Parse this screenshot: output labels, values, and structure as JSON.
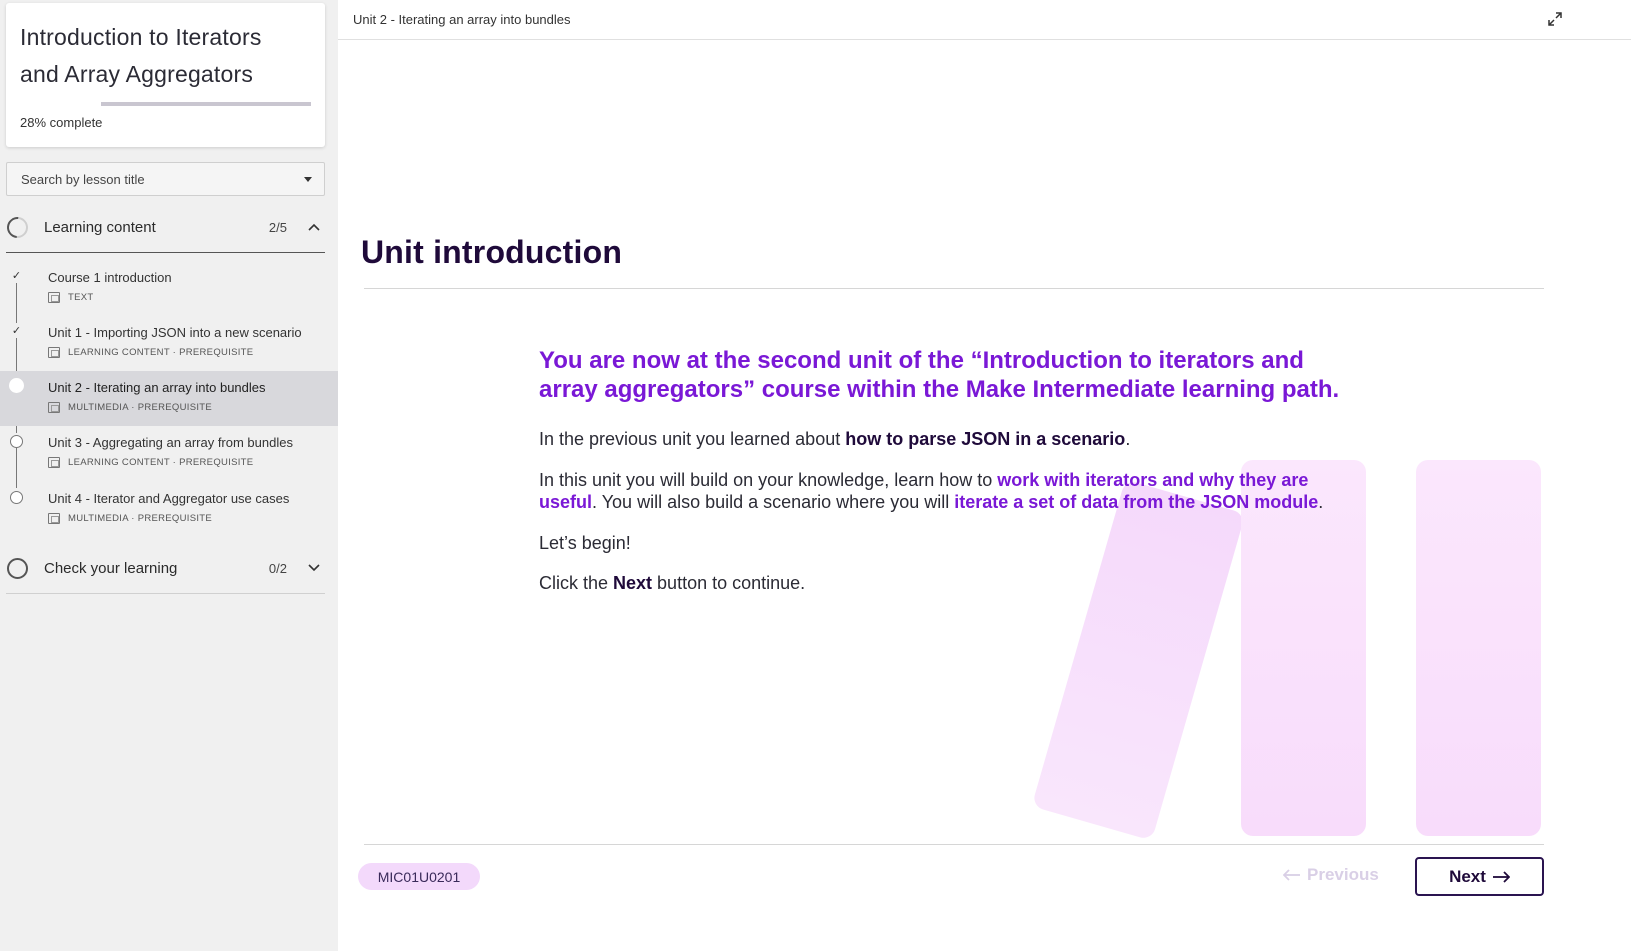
{
  "sidebar": {
    "course_title": "Introduction to Iterators and Array Aggregators",
    "progress": {
      "percent_label": "28%",
      "complete_label": "complete",
      "fraction": 0.28
    },
    "search": {
      "label": "Search by lesson title"
    },
    "sections": [
      {
        "label": "Learning content",
        "count": "2/5",
        "expanded": true,
        "lessons": [
          {
            "title": "Course 1 introduction",
            "meta": "TEXT",
            "status": "done",
            "icon": "text-doc-icon"
          },
          {
            "title": "Unit 1 - Importing JSON into a new scenario",
            "meta": "LEARNING CONTENT · PREREQUISITE",
            "status": "done",
            "icon": "screen-icon"
          },
          {
            "title": "Unit 2 - Iterating an array into bundles",
            "meta": "MULTIMEDIA · PREREQUISITE",
            "status": "current",
            "icon": "screen-icon"
          },
          {
            "title": "Unit 3 - Aggregating an array from bundles",
            "meta": "LEARNING CONTENT · PREREQUISITE",
            "status": "todo",
            "icon": "screen-icon"
          },
          {
            "title": "Unit 4 - Iterator and Aggregator use cases",
            "meta": "MULTIMEDIA · PREREQUISITE",
            "status": "todo",
            "icon": "screen-icon"
          }
        ]
      },
      {
        "label": "Check your learning",
        "count": "0/2",
        "expanded": false
      }
    ]
  },
  "main": {
    "breadcrumb": "Unit 2 - Iterating an array into bundles",
    "heading": "Unit introduction",
    "lead": "You are now at the second unit of the “Introduction to iterators and array aggregators” course within the Make Intermediate learning path.",
    "p1": {
      "a": "In the previous unit you learned about ",
      "b": "how to parse JSON in a scenario",
      "c": "."
    },
    "p2": {
      "a": "In this unit you will build on your knowledge, learn how to ",
      "b": "work with iterators and why they are useful",
      "c": ". You will also build a scenario where you will ",
      "d": "iterate a set of data from the JSON module",
      "e": "."
    },
    "p3": "Let’s begin!",
    "p4": {
      "a": "Click the ",
      "b": "Next",
      "c": " button to continue."
    },
    "code": "MIC01U0201",
    "prev_label": "Previous",
    "next_label": "Next"
  },
  "colors": {
    "accent": "#7a18d6",
    "dark": "#1f0a3a",
    "pill": "#f3d9fb"
  }
}
